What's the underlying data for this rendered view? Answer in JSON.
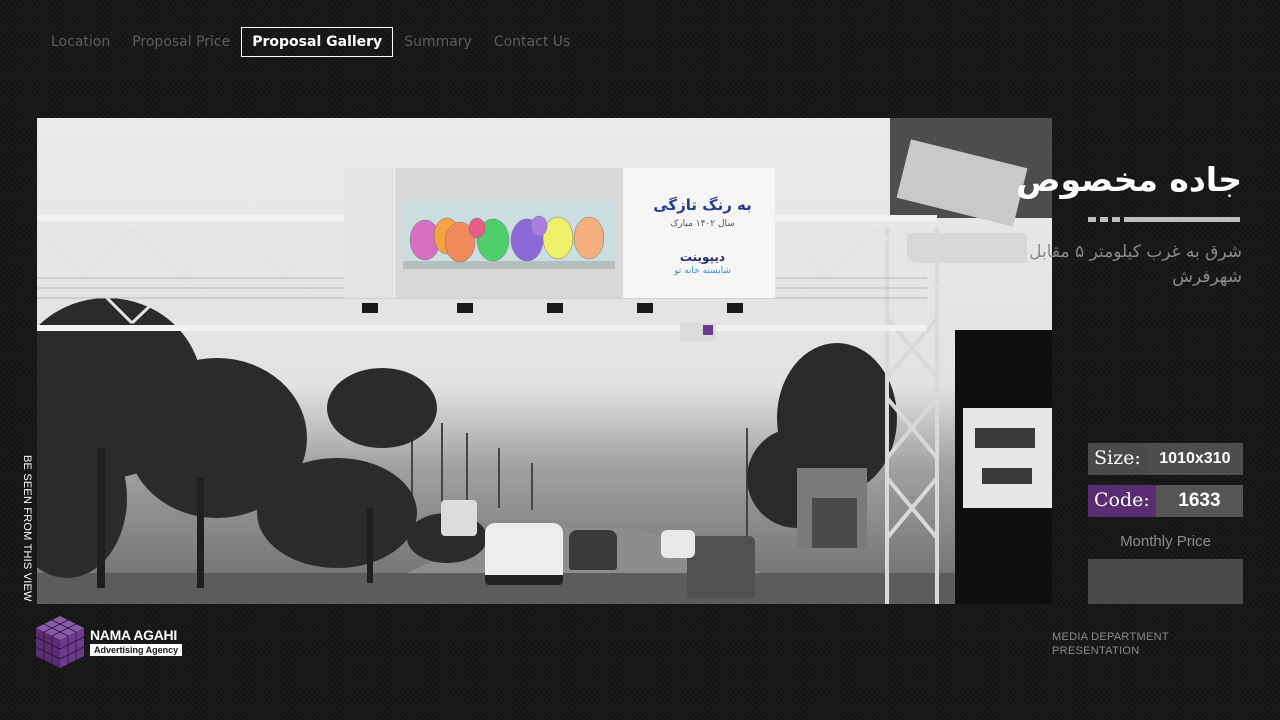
{
  "nav": {
    "items": [
      {
        "label": "Location",
        "active": false
      },
      {
        "label": "Proposal Price",
        "active": false
      },
      {
        "label": "Proposal Gallery",
        "active": true
      },
      {
        "label": "Summary",
        "active": false
      },
      {
        "label": "Contact Us",
        "active": false
      }
    ]
  },
  "photo": {
    "side_caption": "BE SEEN FROM THIS VIEW",
    "billboard": {
      "headline": "به رنگ تازگی",
      "subline": "سال ۱۴۰۲ مبارک",
      "brand": "دیپوینت",
      "slogan": "شایسته خانه تو"
    }
  },
  "panel": {
    "title": "جاده مخصوص",
    "subtitle": "شرق به غرب کیلومتر ۵ مقابل شهرفرش",
    "size_label": "Size:",
    "size_value": "1010x310",
    "code_label": "Code:",
    "code_value": "1633",
    "monthly_price_label": "Monthly Price",
    "monthly_price_value": ""
  },
  "footer": {
    "brand_name": "NAMA AGAHI",
    "brand_tagline": "Advertising Agency",
    "note_line1": "MEDIA DEPARTMENT",
    "note_line2": "PRESENTATION"
  },
  "colors": {
    "background": "#151515",
    "accent_purple": "#5a2d72",
    "panel_box": "#4a4a4a"
  }
}
